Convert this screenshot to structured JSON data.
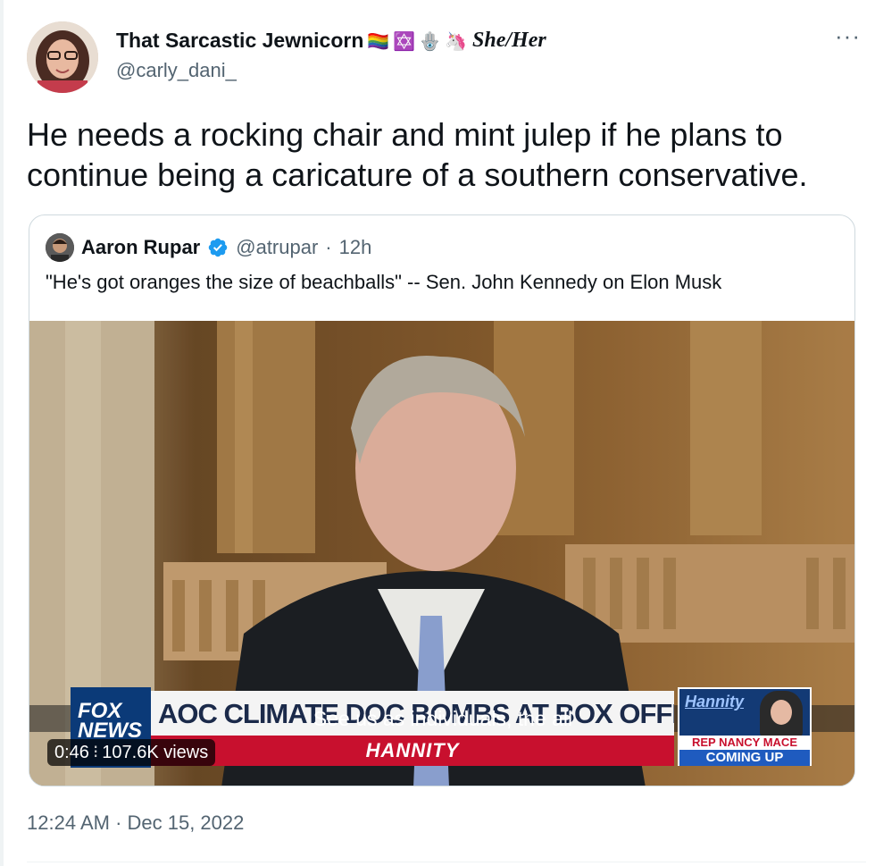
{
  "tweet": {
    "display_name": "That Sarcastic Jewnicorn",
    "name_emojis": [
      "🏳️‍🌈",
      "✡️",
      "🪬",
      "🦄"
    ],
    "pronouns": "She/Her",
    "handle": "@carly_dani_",
    "more_icon": "more-horizontal-icon",
    "text": "He needs a rocking chair and mint julep if he plans to continue being a caricature of a southern conservative.",
    "timestamp": "12:24 AM · Dec 15, 2022"
  },
  "quoted": {
    "display_name": "Aaron Rupar",
    "verified_icon": "verified-badge-icon",
    "handle": "@atrupar",
    "dot": "·",
    "time": "12h",
    "text": "\"He's got oranges the size of beachballs\" -- Sen. John Kennedy on Elon Musk",
    "video": {
      "chyron_logo_top": "FOX",
      "chyron_logo_bottom": "NEWS",
      "headline": "AOC CLIMATE DOC BOMBS AT BOX OFFICE",
      "show": "HANNITY",
      "promo_brand": "Hannity",
      "promo_line1": "REP NANCY MACE",
      "promo_line2": "COMING UP",
      "caption": "See us as individuals, the all",
      "duration": "0:46",
      "views": "107.6K views"
    }
  },
  "colors": {
    "text_primary": "#0f1419",
    "text_secondary": "#536471",
    "border": "#cfd9de",
    "verified_blue": "#1d9bf0",
    "fox_red": "#c8102e",
    "fox_blue": "#0b3a78"
  }
}
